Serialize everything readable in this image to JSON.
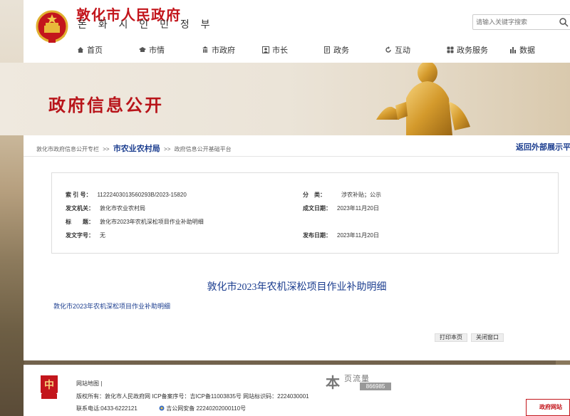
{
  "header": {
    "title": "敦化市人民政府",
    "subtitle": "돈 화 시 인 민 정 부",
    "search_placeholder": "请输入关键字搜索"
  },
  "nav": [
    {
      "label": "首页",
      "icon": "home-icon"
    },
    {
      "label": "市情",
      "icon": "hat-icon"
    },
    {
      "label": "市政府",
      "icon": "building-icon"
    },
    {
      "label": "市长",
      "icon": "person-icon"
    },
    {
      "label": "政务",
      "icon": "doc-icon"
    },
    {
      "label": "互动",
      "icon": "refresh-icon"
    },
    {
      "label": "政务服务",
      "icon": "grid-icon"
    },
    {
      "label": "数据",
      "icon": "bar-chart-icon"
    }
  ],
  "banner": {
    "title": "政府信息公开"
  },
  "breadcrumb": {
    "item1": "敦化市政府信息公开专栏",
    "sep": ">>",
    "item2": "市农业农村局",
    "item3": "政府信息公开基础平台",
    "return_link": "返回外部展示平"
  },
  "info": {
    "index_label": "索 引 号：",
    "index_value": "11222403013560293B/2023-15820",
    "category_label": "分　类：",
    "category_value": "涉农补贴；公示",
    "issuer_label": "发文机关：",
    "issuer_value": "敦化市农业农村局",
    "created_label": "成文日期：",
    "created_value": "2023年11月20日",
    "title_label": "标　　题：",
    "title_value": "敦化市2023年农机深松项目作业补助明细",
    "docno_label": "发文字号：",
    "docno_value": "无",
    "published_label": "发布日期：",
    "published_value": "2023年11月20日"
  },
  "content": {
    "doc_title": "敦化市2023年农机深松项目作业补助明细",
    "attachment": "敦化市2023年农机深松项目作业补助明细",
    "print_button": "打印本页",
    "close_button": "关闭窗口"
  },
  "footer": {
    "sitemap": "网站地图 |",
    "copyright": "版权所有：敦化市人民政府网 ICP备案序号：吉ICP备11003835号 网站标识码：2224030001",
    "contact": "联系电话:0433-6222121",
    "police": "吉公网安备 22240202000110号",
    "counter_big": "本",
    "counter_label": "页流量",
    "counter_value": "866985",
    "corner_badge": "政府网站"
  },
  "colors": {
    "brand_red": "#c3161c",
    "link_blue": "#1b3d8f"
  }
}
